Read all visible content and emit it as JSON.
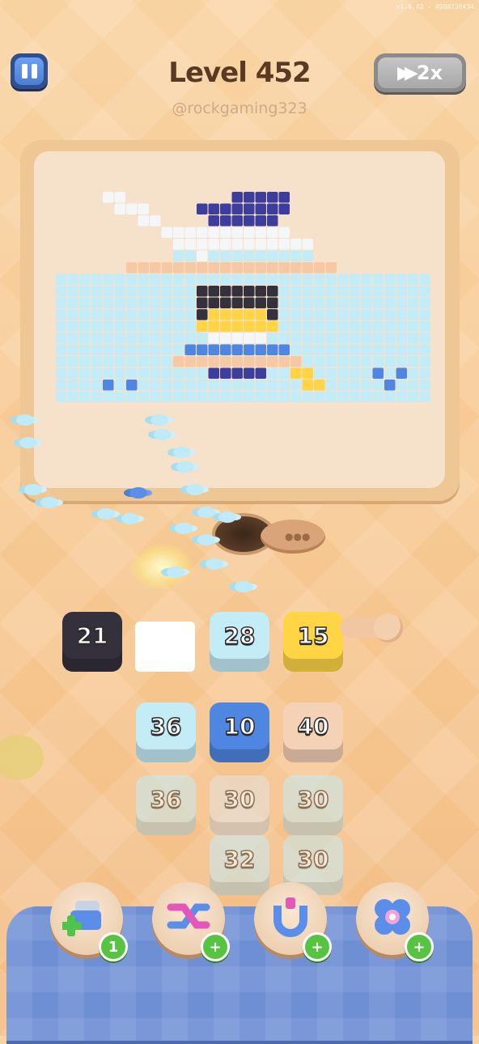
{
  "version": "v1.0.42 - 4908736434",
  "header": {
    "title": "Level 452",
    "username": "@rockgaming323",
    "speed_label": "2x"
  },
  "queue_blocks": [
    {
      "count": "21",
      "color": "#34303c"
    },
    {
      "count": "",
      "color": "#ffffff"
    },
    {
      "count": "28",
      "color": "#c4ecf6"
    },
    {
      "count": "15",
      "color": "#ffd545"
    },
    {
      "count": "",
      "color": "#f5d1b6"
    }
  ],
  "grid_blocks": [
    [
      {
        "count": "36",
        "color": "#c4ecf6"
      },
      {
        "count": "10",
        "color": "#4f86e2"
      },
      {
        "count": "40",
        "color": "#f5d1b6"
      }
    ],
    [
      {
        "count": "36",
        "color": "#c4ecf6"
      },
      {
        "count": "30",
        "color": "#e3e3e3"
      },
      {
        "count": "30",
        "color": "#c4ecf6"
      }
    ],
    [
      {
        "count": "",
        "color": ""
      },
      {
        "count": "32",
        "color": "#c4ecf6"
      },
      {
        "count": "30",
        "color": "#c4ecf6"
      }
    ]
  ],
  "powerups": [
    {
      "name": "add-slot",
      "icon": "add-slot-icon",
      "badge": "1"
    },
    {
      "name": "shuffle",
      "icon": "shuffle-icon",
      "badge": "+"
    },
    {
      "name": "magnet",
      "icon": "magnet-icon",
      "badge": "+"
    },
    {
      "name": "bomb",
      "icon": "flower-icon",
      "badge": "+"
    }
  ],
  "colors": {
    "light_blue": "#c4ecf6",
    "blue": "#4f86e2",
    "navy": "#3d3d9e",
    "white": "#f4f6f8",
    "peach": "#f6c9a4",
    "yellow": "#ffd545",
    "dark": "#34303c"
  }
}
